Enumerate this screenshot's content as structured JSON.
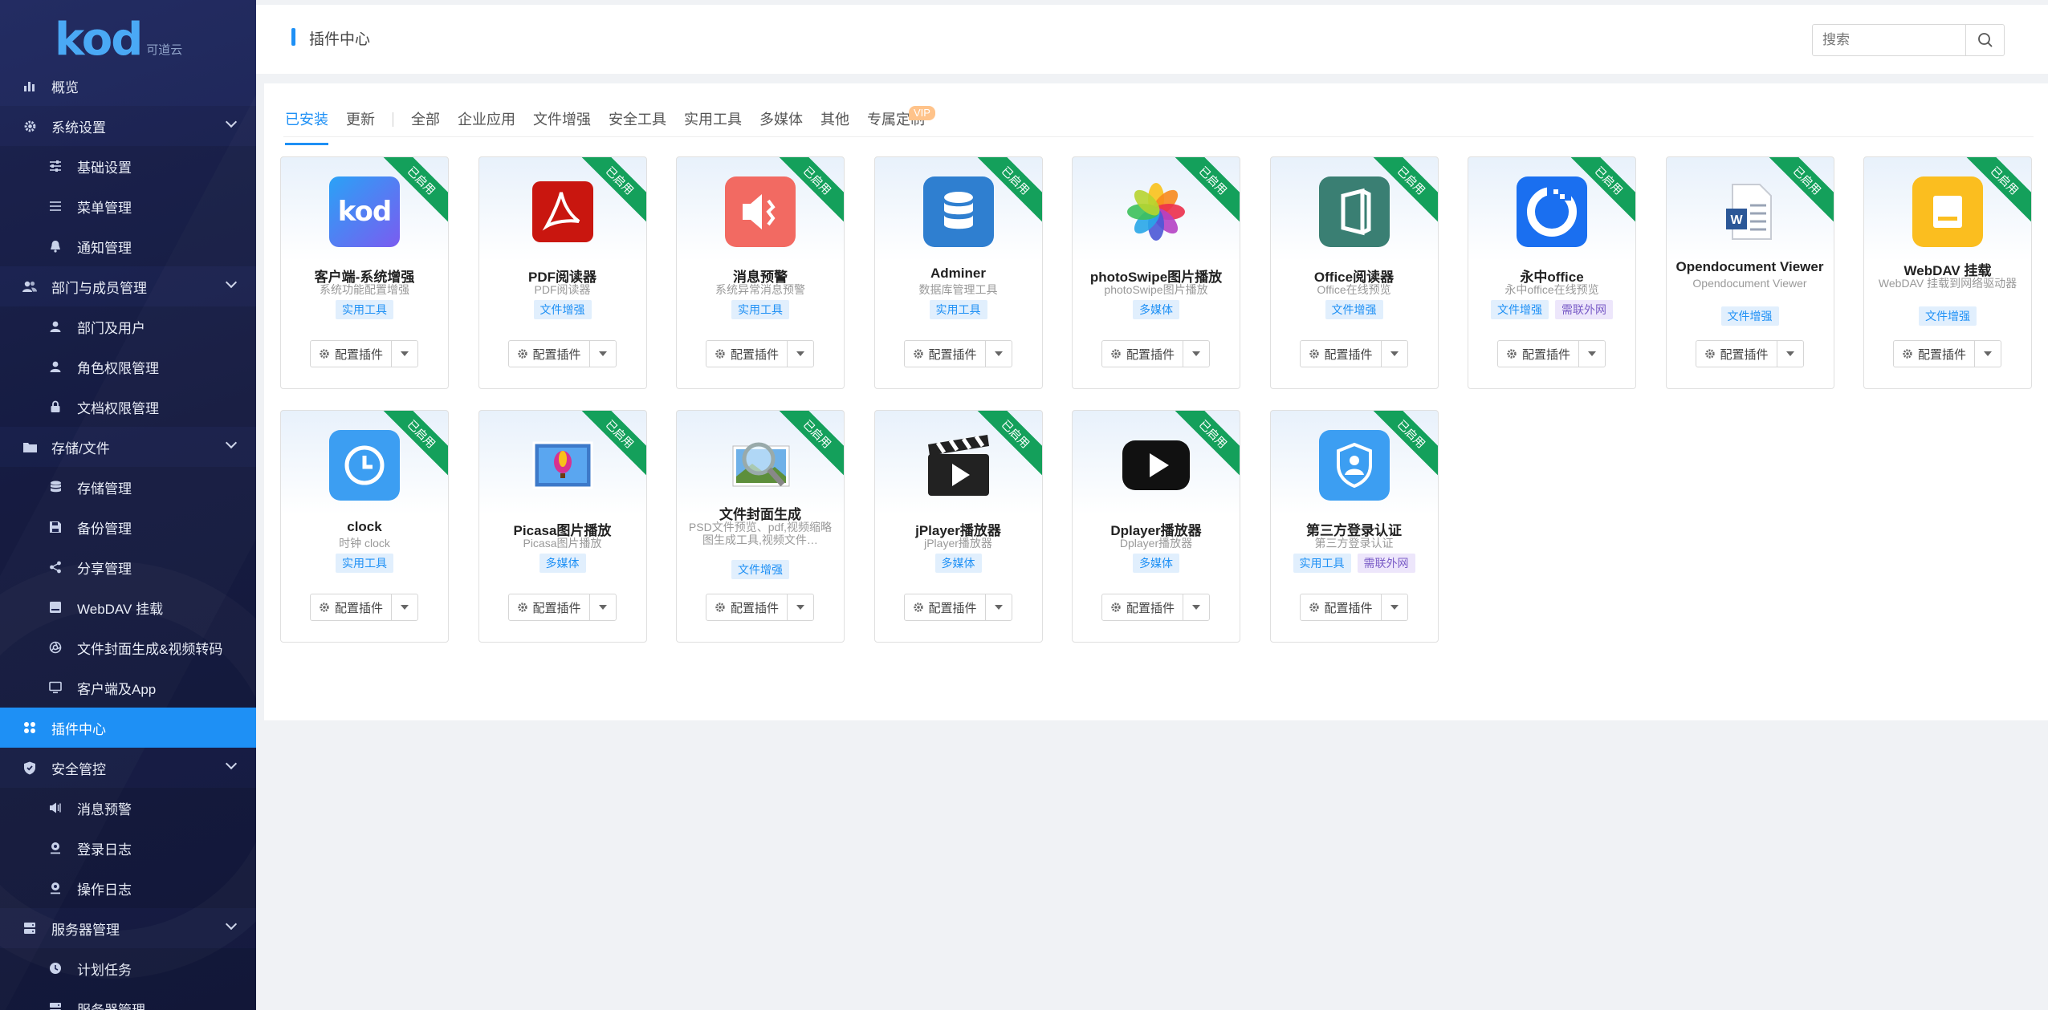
{
  "logo": {
    "text": "kod",
    "sub": "可道云"
  },
  "sidebar": {
    "items": [
      {
        "label": "概览",
        "kind": "top",
        "icon": "bar-chart-icon"
      },
      {
        "label": "系统设置",
        "kind": "parent",
        "icon": "gear-icon"
      },
      {
        "label": "基础设置",
        "kind": "child",
        "icon": "sliders-icon"
      },
      {
        "label": "菜单管理",
        "kind": "child",
        "icon": "list-icon"
      },
      {
        "label": "通知管理",
        "kind": "child",
        "icon": "bell-icon"
      },
      {
        "label": "部门与成员管理",
        "kind": "parent",
        "icon": "users-icon"
      },
      {
        "label": "部门及用户",
        "kind": "child",
        "icon": "user-icon"
      },
      {
        "label": "角色权限管理",
        "kind": "child",
        "icon": "user-icon"
      },
      {
        "label": "文档权限管理",
        "kind": "child",
        "icon": "lock-icon"
      },
      {
        "label": "存储/文件",
        "kind": "parent",
        "icon": "folder-icon"
      },
      {
        "label": "存储管理",
        "kind": "child",
        "icon": "database-icon"
      },
      {
        "label": "备份管理",
        "kind": "child",
        "icon": "save-icon"
      },
      {
        "label": "分享管理",
        "kind": "child",
        "icon": "share-icon"
      },
      {
        "label": "WebDAV 挂载",
        "kind": "child",
        "icon": "drive-icon"
      },
      {
        "label": "文件封面生成&视频转码",
        "kind": "child",
        "icon": "aperture-icon"
      },
      {
        "label": "客户端及App",
        "kind": "child",
        "icon": "monitor-icon"
      },
      {
        "label": "插件中心",
        "kind": "top",
        "icon": "grid-icon",
        "active": true
      },
      {
        "label": "安全管控",
        "kind": "parent",
        "icon": "shield-icon"
      },
      {
        "label": "消息预警",
        "kind": "child",
        "icon": "speaker-icon"
      },
      {
        "label": "登录日志",
        "kind": "child",
        "icon": "pin-icon"
      },
      {
        "label": "操作日志",
        "kind": "child",
        "icon": "pin-icon"
      },
      {
        "label": "服务器管理",
        "kind": "parent",
        "icon": "server-icon"
      },
      {
        "label": "计划任务",
        "kind": "child",
        "icon": "clock-icon"
      },
      {
        "label": "服务器管理",
        "kind": "child",
        "icon": "server-icon"
      }
    ]
  },
  "header": {
    "title": "插件中心",
    "search_placeholder": "搜索"
  },
  "tabs": [
    {
      "label": "已安装",
      "active": true
    },
    {
      "label": "更新"
    },
    {
      "label": "全部"
    },
    {
      "label": "企业应用"
    },
    {
      "label": "文件增强"
    },
    {
      "label": "安全工具"
    },
    {
      "label": "实用工具"
    },
    {
      "label": "多媒体"
    },
    {
      "label": "其他"
    },
    {
      "label": "专属定制",
      "badge": "VIP"
    }
  ],
  "ribbon_label": "已启用",
  "config_label": "配置插件",
  "plugins": [
    {
      "name": "客户端-系统增强",
      "desc": "系统功能配置增强",
      "tags": [
        "实用工具"
      ],
      "icon": "kod-icon"
    },
    {
      "name": "PDF阅读器",
      "desc": "PDF阅读器",
      "tags": [
        "文件增强"
      ],
      "icon": "pdf-icon"
    },
    {
      "name": "消息预警",
      "desc": "系统异常消息预警",
      "tags": [
        "实用工具"
      ],
      "icon": "alert-speaker-icon"
    },
    {
      "name": "Adminer",
      "desc": "数据库管理工具",
      "tags": [
        "实用工具"
      ],
      "icon": "database-icon"
    },
    {
      "name": "photoSwipe图片播放",
      "desc": "photoSwipe图片播放",
      "tags": [
        "多媒体"
      ],
      "icon": "photos-flower-icon"
    },
    {
      "name": "Office阅读器",
      "desc": "Office在线预览",
      "tags": [
        "文件增强"
      ],
      "icon": "office-icon"
    },
    {
      "name": "永中office",
      "desc": "永中office在线预览",
      "tags": [
        "文件增强",
        "需联外网"
      ],
      "icon": "yozo-icon"
    },
    {
      "name": "Opendocument Viewer",
      "desc": "Opendocument Viewer",
      "tags": [
        "文件增强"
      ],
      "icon": "word-doc-icon"
    },
    {
      "name": "WebDAV 挂载",
      "desc": "WebDAV 挂载到网络驱动器",
      "tags": [
        "文件增强"
      ],
      "icon": "webdav-drive-icon"
    },
    {
      "name": "clock",
      "desc": "时钟 clock",
      "tags": [
        "实用工具"
      ],
      "icon": "clock-icon"
    },
    {
      "name": "Picasa图片播放",
      "desc": "Picasa图片播放",
      "tags": [
        "多媒体"
      ],
      "icon": "picasa-icon"
    },
    {
      "name": "文件封面生成",
      "desc": "PSD文件预览、pdf,视频缩略图生成工具,视频文件…",
      "tags": [
        "文件增强"
      ],
      "icon": "magnifier-photo-icon"
    },
    {
      "name": "jPlayer播放器",
      "desc": "jPlayer播放器",
      "tags": [
        "多媒体"
      ],
      "icon": "clapper-icon"
    },
    {
      "name": "Dplayer播放器",
      "desc": "Dplayer播放器",
      "tags": [
        "多媒体"
      ],
      "icon": "play-button-icon"
    },
    {
      "name": "第三方登录认证",
      "desc": "第三方登录认证",
      "tags": [
        "实用工具",
        "需联外网"
      ],
      "icon": "badge-user-icon"
    }
  ]
}
